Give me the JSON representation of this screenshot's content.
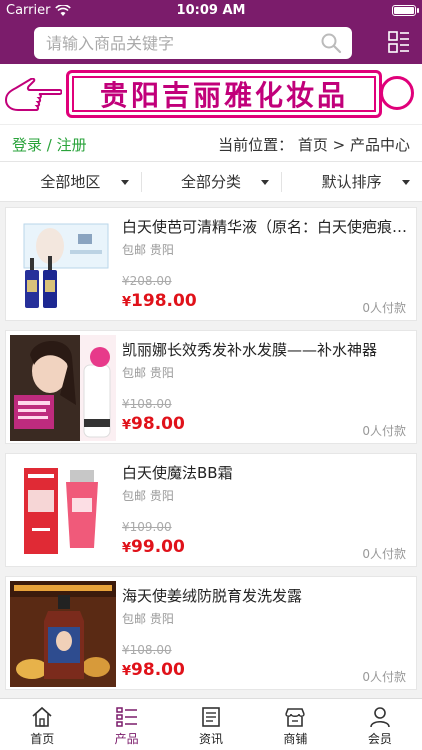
{
  "status": {
    "carrier": "Carrier",
    "time": "10:09 AM"
  },
  "search": {
    "placeholder": "请输入商品关键字",
    "value": ""
  },
  "banner": {
    "title": "贵阳吉丽雅化妆品"
  },
  "breadcrumb": {
    "login": "登录 / 注册",
    "location": "当前位置： 首页 > 产品中心"
  },
  "filters": [
    {
      "label": "全部地区"
    },
    {
      "label": "全部分类"
    },
    {
      "label": "默认排序"
    }
  ],
  "products": [
    {
      "name": "白天使芭可清精华液（原名：白天使疤痕修复精华液）",
      "shop": "包邮",
      "city": "贵阳",
      "old_price": "¥208.00",
      "price_symbol": "¥",
      "price": "198.00",
      "sold": "0人付款"
    },
    {
      "name": "凯丽娜长效秀发补水发膜——补水神器",
      "shop": "包邮",
      "city": "贵阳",
      "old_price": "¥108.00",
      "price_symbol": "¥",
      "price": "98.00",
      "sold": "0人付款"
    },
    {
      "name": "白天使魔法BB霜",
      "shop": "包邮",
      "city": "贵阳",
      "old_price": "¥109.00",
      "price_symbol": "¥",
      "price": "99.00",
      "sold": "0人付款"
    },
    {
      "name": "海天使姜绒防脱育发洗发露",
      "shop": "包邮",
      "city": "贵阳",
      "old_price": "¥108.00",
      "price_symbol": "¥",
      "price": "98.00",
      "sold": "0人付款"
    }
  ],
  "tabs": [
    {
      "label": "首页",
      "icon": "home-icon"
    },
    {
      "label": "产品",
      "icon": "list-icon"
    },
    {
      "label": "资讯",
      "icon": "news-icon"
    },
    {
      "label": "商铺",
      "icon": "shop-icon"
    },
    {
      "label": "会员",
      "icon": "user-icon"
    }
  ],
  "colors": {
    "brand": "#7b1c6b",
    "accent": "#e0007a",
    "price": "#e0121a",
    "login": "#2aa33b"
  }
}
